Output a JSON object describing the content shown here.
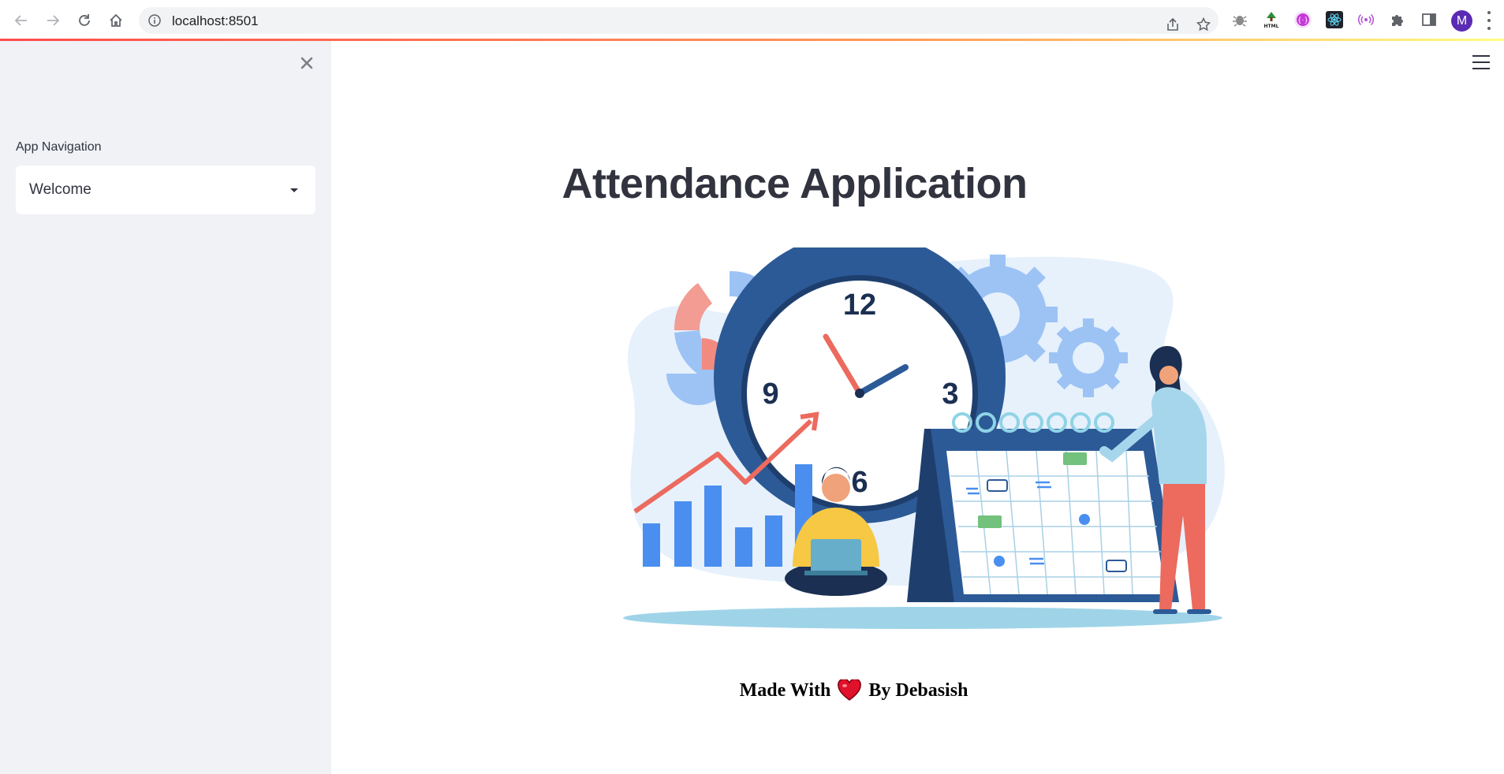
{
  "browser": {
    "url": "localhost:8501",
    "profile_initial": "M",
    "extensions": [
      "bug-icon",
      "html-icon",
      "graphql-icon",
      "react-icon",
      "broadcast-icon",
      "puzzle-icon"
    ]
  },
  "sidebar": {
    "nav_label": "App Navigation",
    "selected_page": "Welcome"
  },
  "main": {
    "title": "Attendance Application",
    "credit": {
      "prefix": "Made With",
      "suffix": "By Debasish"
    },
    "illustration": {
      "clock_numbers": [
        "12",
        "3",
        "6",
        "9"
      ]
    }
  },
  "colors": {
    "accent_red": "#ff4b4b",
    "sidebar_bg": "#f0f2f6",
    "text": "#31333f"
  }
}
